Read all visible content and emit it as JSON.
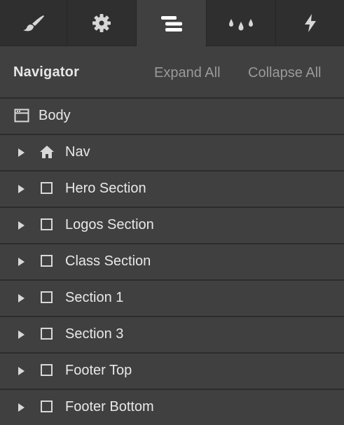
{
  "tabs": [
    {
      "id": "style",
      "icon": "brush-icon",
      "active": false
    },
    {
      "id": "settings",
      "icon": "gear-icon",
      "active": false
    },
    {
      "id": "navigator",
      "icon": "navigator-icon",
      "active": true
    },
    {
      "id": "swatches",
      "icon": "drops-icon",
      "active": false
    },
    {
      "id": "interactions",
      "icon": "lightning-icon",
      "active": false
    }
  ],
  "navigator": {
    "title": "Navigator",
    "expand_all": "Expand All",
    "collapse_all": "Collapse All"
  },
  "tree": {
    "root": {
      "label": "Body",
      "icon": "page-icon"
    },
    "items": [
      {
        "label": "Nav",
        "icon": "home-icon"
      },
      {
        "label": "Hero Section",
        "icon": "box-icon"
      },
      {
        "label": "Logos Section",
        "icon": "box-icon"
      },
      {
        "label": "Class Section",
        "icon": "box-icon"
      },
      {
        "label": "Section 1",
        "icon": "box-icon"
      },
      {
        "label": "Section 3",
        "icon": "box-icon"
      },
      {
        "label": "Footer Top",
        "icon": "box-icon"
      },
      {
        "label": "Footer Bottom",
        "icon": "box-icon"
      }
    ]
  },
  "colors": {
    "panel": "#404040",
    "tabbar": "#2f2f2f",
    "divider": "#2c2c2c",
    "text": "#e8e8e8",
    "muted": "#9a9a9a"
  }
}
